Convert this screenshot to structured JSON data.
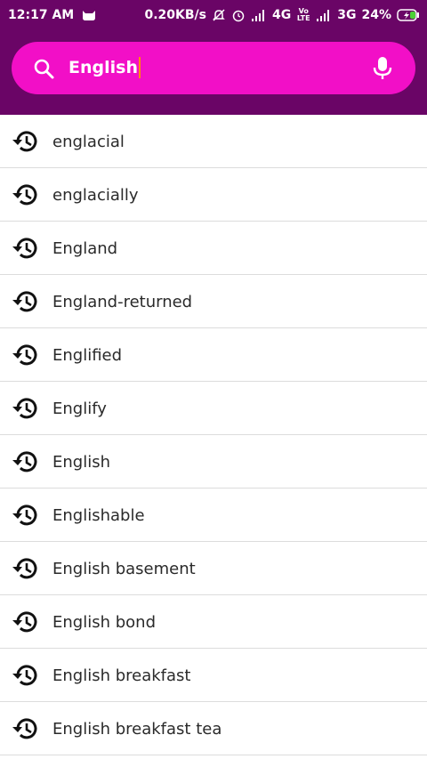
{
  "status_bar": {
    "time": "12:17 AM",
    "speed": "0.20KB/s",
    "network1": "4G",
    "volte": "Vo LTE",
    "network2": "3G",
    "battery": "24%"
  },
  "search": {
    "query": "English"
  },
  "suggestions": [
    "englacial",
    "englacially",
    "England",
    "England-returned",
    "Englified",
    "Englify",
    "English",
    "Englishable",
    "English basement",
    "English bond",
    "English breakfast",
    "English breakfast tea"
  ],
  "icons": {
    "search": "search-icon",
    "mic": "microphone-icon",
    "history": "history-icon"
  },
  "colors": {
    "header": "#6a0566",
    "search_bg": "#f20fc7",
    "caret": "#ff8a00"
  }
}
